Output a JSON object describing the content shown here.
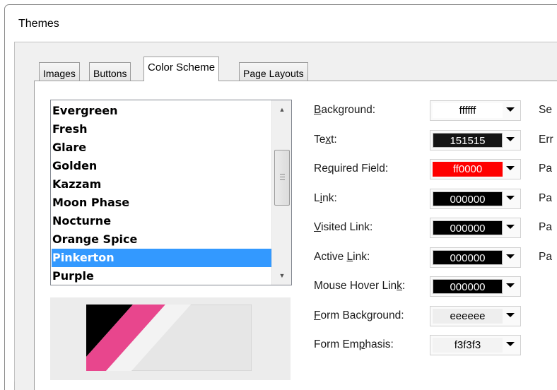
{
  "window": {
    "title": "Themes"
  },
  "tabs": [
    {
      "label": "Images",
      "active": false
    },
    {
      "label": "Buttons",
      "active": false
    },
    {
      "label": "Color Scheme",
      "active": true
    },
    {
      "label": "Page Layouts",
      "active": false
    }
  ],
  "scheme_list": {
    "items": [
      "Evergreen",
      "Fresh",
      "Glare",
      "Golden",
      "Kazzam",
      "Moon Phase",
      "Nocturne",
      "Orange Spice",
      "Pinkerton",
      "Purple"
    ],
    "selected": "Pinkerton"
  },
  "preview": {
    "colors": {
      "black": "#000000",
      "pink": "#e8468d",
      "light": "#f3f3f3",
      "panel": "#e6e6e6"
    }
  },
  "color_fields": [
    {
      "label_pre": "",
      "mnemonic": "B",
      "label_post": "ackground:",
      "value": "ffffff",
      "swatch": "#ffffff",
      "text_color": "#000000"
    },
    {
      "label_pre": "Te",
      "mnemonic": "x",
      "label_post": "t:",
      "value": "151515",
      "swatch": "#151515",
      "text_color": "#ffffff"
    },
    {
      "label_pre": "Re",
      "mnemonic": "q",
      "label_post": "uired Field:",
      "value": "ff0000",
      "swatch": "#ff0000",
      "text_color": "#ffffff"
    },
    {
      "label_pre": "L",
      "mnemonic": "i",
      "label_post": "nk:",
      "value": "000000",
      "swatch": "#000000",
      "text_color": "#ffffff"
    },
    {
      "label_pre": "",
      "mnemonic": "V",
      "label_post": "isited Link:",
      "value": "000000",
      "swatch": "#000000",
      "text_color": "#ffffff"
    },
    {
      "label_pre": "Active ",
      "mnemonic": "L",
      "label_post": "ink:",
      "value": "000000",
      "swatch": "#000000",
      "text_color": "#ffffff"
    },
    {
      "label_pre": "Mouse Hover Lin",
      "mnemonic": "k",
      "label_post": ":",
      "value": "000000",
      "swatch": "#000000",
      "text_color": "#ffffff"
    },
    {
      "label_pre": "",
      "mnemonic": "F",
      "label_post": "orm Background:",
      "value": "eeeeee",
      "swatch": "#eeeeee",
      "text_color": "#000000"
    },
    {
      "label_pre": "Form Em",
      "mnemonic": "p",
      "label_post": "hasis:",
      "value": "f3f3f3",
      "swatch": "#f3f3f3",
      "text_color": "#000000"
    }
  ],
  "right_column": [
    "Se",
    "Err",
    "Pa",
    "Pa",
    "Pa",
    "Pa"
  ]
}
